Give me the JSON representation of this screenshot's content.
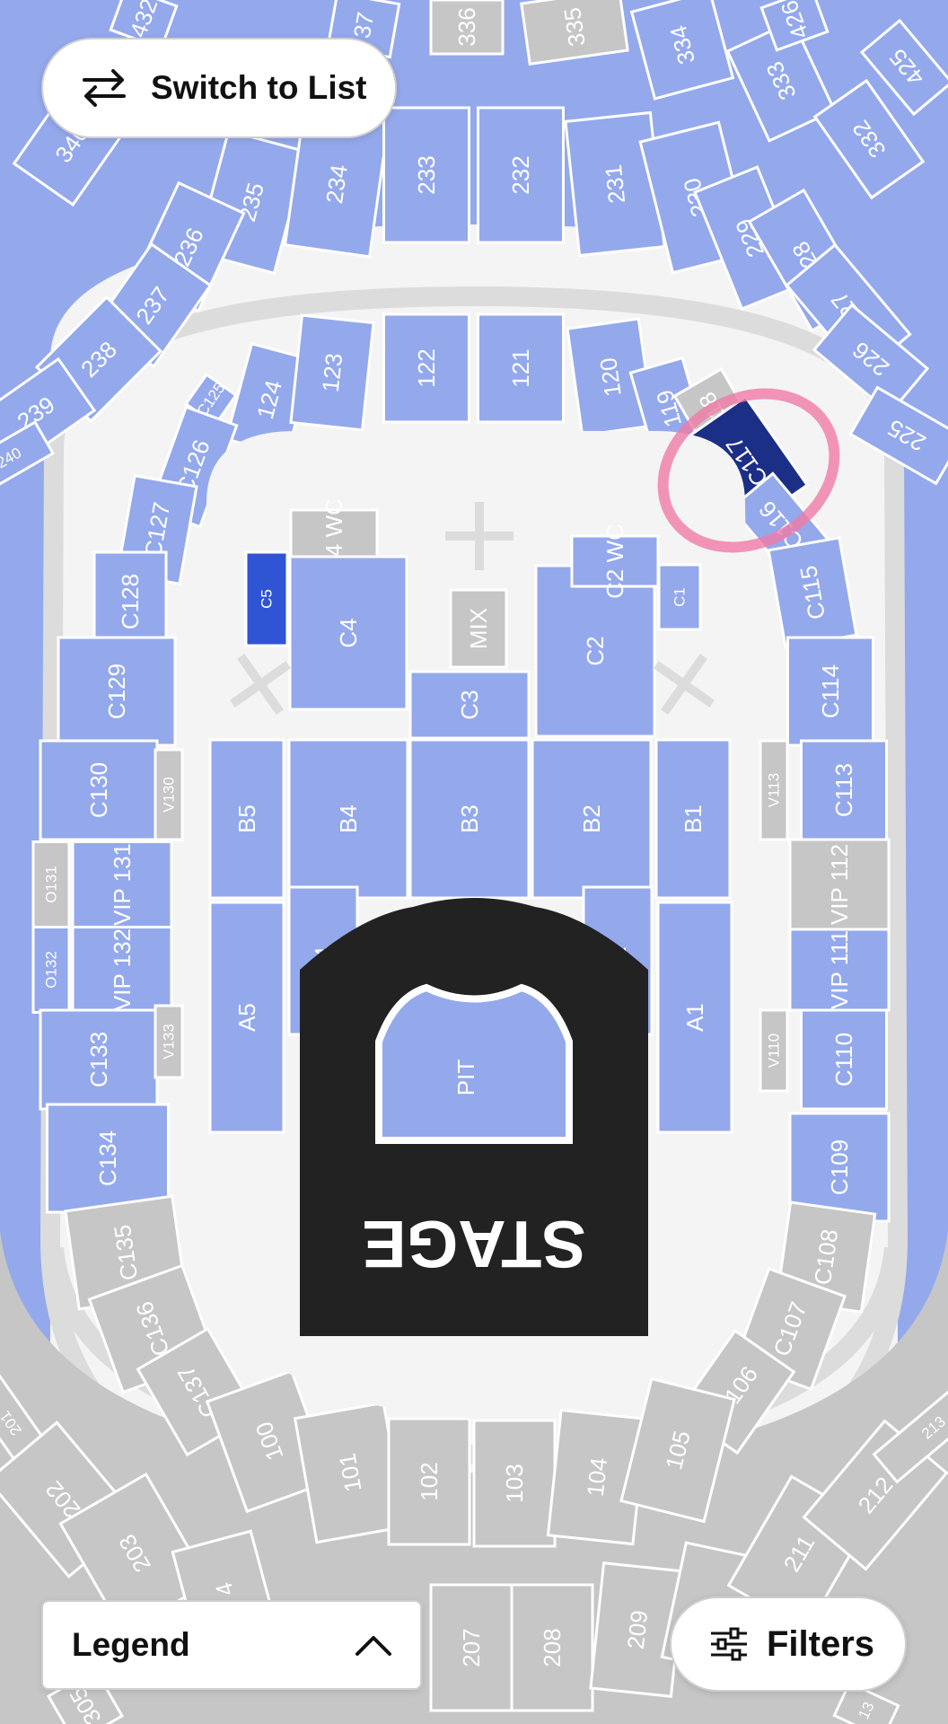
{
  "controls": {
    "switch_label": "Switch to List",
    "legend_label": "Legend",
    "filters_label": "Filters"
  },
  "map": {
    "stage_label": "STAGE",
    "colors": {
      "available": "#94a9ec",
      "unavailable": "#c6c6c6",
      "selected": "#1c2f86",
      "highlighted": "#2f55d4",
      "stage": "#222222",
      "floor": "#f4f4f4",
      "annotation": "#f07aa7"
    },
    "sections": [
      {
        "label": "336",
        "status": "unavailable"
      },
      {
        "label": "335",
        "status": "unavailable"
      },
      {
        "label": "334",
        "status": "available"
      },
      {
        "label": "333",
        "status": "available"
      },
      {
        "label": "332",
        "status": "available"
      },
      {
        "label": "426",
        "status": "available"
      },
      {
        "label": "425",
        "status": "available"
      },
      {
        "label": "432",
        "status": "available"
      },
      {
        "label": "37",
        "status": "available"
      },
      {
        "label": "340",
        "status": "available"
      },
      {
        "label": "235",
        "status": "available"
      },
      {
        "label": "234",
        "status": "available"
      },
      {
        "label": "233",
        "status": "available"
      },
      {
        "label": "232",
        "status": "available"
      },
      {
        "label": "231",
        "status": "available"
      },
      {
        "label": "230",
        "status": "available"
      },
      {
        "label": "229",
        "status": "available"
      },
      {
        "label": "228",
        "status": "available"
      },
      {
        "label": "227",
        "status": "available"
      },
      {
        "label": "226",
        "status": "available"
      },
      {
        "label": "225",
        "status": "available"
      },
      {
        "label": "236",
        "status": "available"
      },
      {
        "label": "237",
        "status": "available"
      },
      {
        "label": "238",
        "status": "available"
      },
      {
        "label": "239",
        "status": "available"
      },
      {
        "label": "240",
        "status": "available"
      },
      {
        "label": "124",
        "status": "available"
      },
      {
        "label": "123",
        "status": "available"
      },
      {
        "label": "122",
        "status": "available"
      },
      {
        "label": "121",
        "status": "available"
      },
      {
        "label": "120",
        "status": "available"
      },
      {
        "label": "119",
        "status": "available"
      },
      {
        "label": "C118",
        "status": "unavailable"
      },
      {
        "label": "C117",
        "status": "selected"
      },
      {
        "label": "C116",
        "status": "available"
      },
      {
        "label": "C115",
        "status": "available"
      },
      {
        "label": "C114",
        "status": "available"
      },
      {
        "label": "C113",
        "status": "available"
      },
      {
        "label": "V113",
        "status": "unavailable"
      },
      {
        "label": "VIP 112",
        "status": "unavailable"
      },
      {
        "label": "VIP 111",
        "status": "available"
      },
      {
        "label": "V110",
        "status": "unavailable"
      },
      {
        "label": "C110",
        "status": "available"
      },
      {
        "label": "C109",
        "status": "available"
      },
      {
        "label": "C108",
        "status": "unavailable"
      },
      {
        "label": "C107",
        "status": "unavailable"
      },
      {
        "label": "C106",
        "status": "unavailable"
      },
      {
        "label": "C125",
        "status": "available"
      },
      {
        "label": "C126",
        "status": "available"
      },
      {
        "label": "C127",
        "status": "available"
      },
      {
        "label": "C128",
        "status": "available"
      },
      {
        "label": "C129",
        "status": "available"
      },
      {
        "label": "C130",
        "status": "available"
      },
      {
        "label": "V130",
        "status": "unavailable"
      },
      {
        "label": "O131",
        "status": "unavailable"
      },
      {
        "label": "VIP 131",
        "status": "available"
      },
      {
        "label": "O132",
        "status": "available"
      },
      {
        "label": "VIP 132",
        "status": "available"
      },
      {
        "label": "C133",
        "status": "available"
      },
      {
        "label": "V133",
        "status": "unavailable"
      },
      {
        "label": "C134",
        "status": "available"
      },
      {
        "label": "C135",
        "status": "unavailable"
      },
      {
        "label": "C136",
        "status": "unavailable"
      },
      {
        "label": "C137",
        "status": "unavailable"
      },
      {
        "label": "C5",
        "status": "highlighted"
      },
      {
        "label": "C4 WC",
        "status": "unavailable"
      },
      {
        "label": "C4",
        "status": "available"
      },
      {
        "label": "MIX",
        "status": "unavailable"
      },
      {
        "label": "C3",
        "status": "available"
      },
      {
        "label": "C2",
        "status": "available"
      },
      {
        "label": "C2 WC",
        "status": "available"
      },
      {
        "label": "C1",
        "status": "available"
      },
      {
        "label": "B5",
        "status": "available"
      },
      {
        "label": "B4",
        "status": "available"
      },
      {
        "label": "B3",
        "status": "available"
      },
      {
        "label": "B2",
        "status": "available"
      },
      {
        "label": "B1",
        "status": "available"
      },
      {
        "label": "A5",
        "status": "available"
      },
      {
        "label": "A4",
        "status": "available"
      },
      {
        "label": "A2",
        "status": "available"
      },
      {
        "label": "A1",
        "status": "available"
      },
      {
        "label": "PIT",
        "status": "available"
      },
      {
        "label": "100",
        "status": "unavailable"
      },
      {
        "label": "101",
        "status": "unavailable"
      },
      {
        "label": "102",
        "status": "unavailable"
      },
      {
        "label": "103",
        "status": "unavailable"
      },
      {
        "label": "104",
        "status": "unavailable"
      },
      {
        "label": "105",
        "status": "unavailable"
      },
      {
        "label": "201",
        "status": "unavailable"
      },
      {
        "label": "202",
        "status": "unavailable"
      },
      {
        "label": "203",
        "status": "unavailable"
      },
      {
        "label": "4",
        "status": "unavailable"
      },
      {
        "label": "207",
        "status": "unavailable"
      },
      {
        "label": "208",
        "status": "unavailable"
      },
      {
        "label": "209",
        "status": "unavailable"
      },
      {
        "label": "0",
        "status": "unavailable"
      },
      {
        "label": "211",
        "status": "unavailable"
      },
      {
        "label": "212",
        "status": "unavailable"
      },
      {
        "label": "213",
        "status": "unavailable"
      },
      {
        "label": "305",
        "status": "unavailable"
      },
      {
        "label": "13",
        "status": "unavailable"
      }
    ]
  }
}
